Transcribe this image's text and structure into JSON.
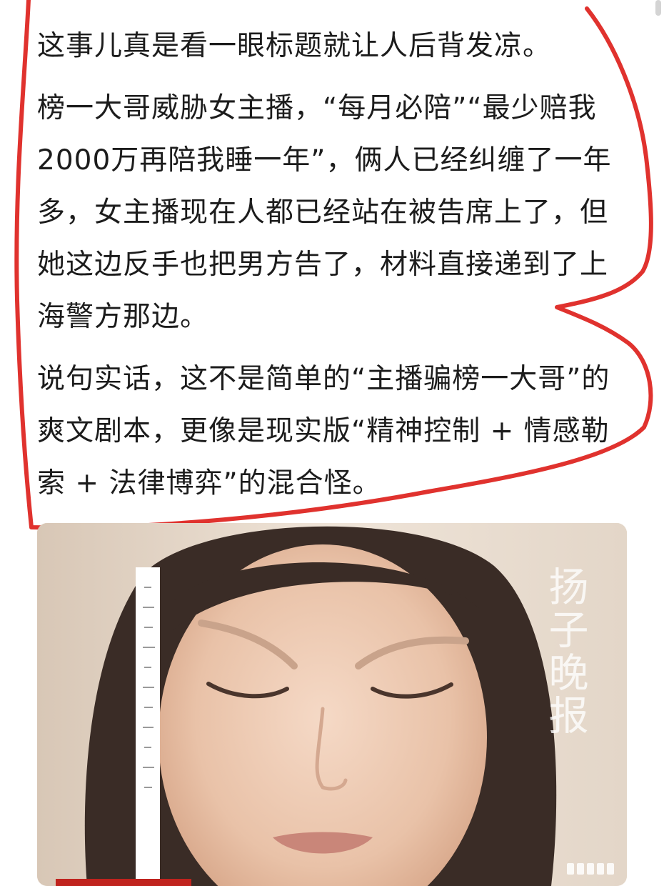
{
  "post": {
    "paragraphs": [
      "这事儿真是看一眼标题就让人后背发凉。",
      "榜一大哥威胁女主播，“每月必陪”“最少赔我2000万再陪我睡一年”，俩人已经纠缠了一年多，女主播现在人都已经站在被告席上了，但她这边反手也把男方告了，材料直接递到了上海警方那边。",
      "说句实话，这不是简单的“主播骗榜一大哥”的爽文剧本，更像是现实版“精神控制 + 情感勒索 + 法律博弈”的混合怪。"
    ]
  },
  "media": {
    "watermark_text": "扬子晚报",
    "page_indicator_icon": "image-pager-icon"
  },
  "colors": {
    "highlight_outline": "#e0322e",
    "text": "#1c1c1c"
  }
}
